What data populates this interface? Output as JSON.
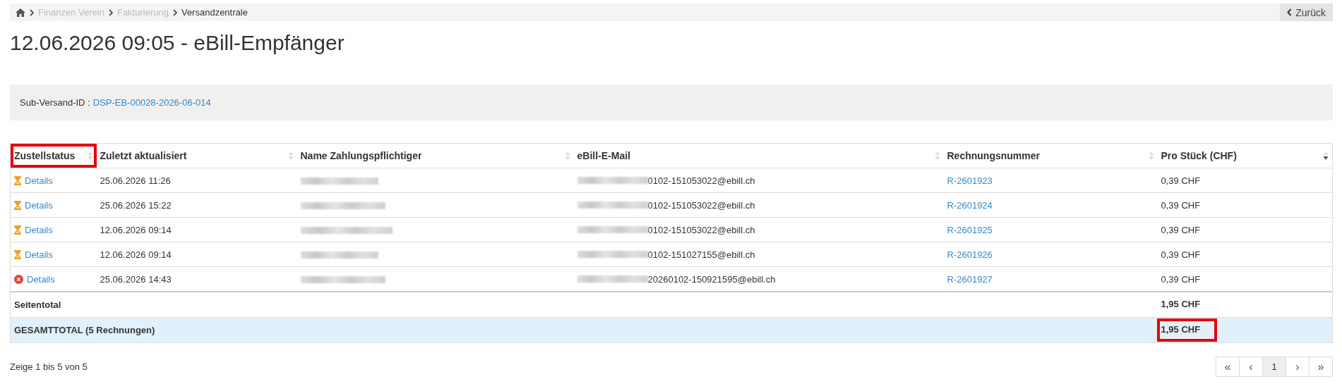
{
  "breadcrumb": {
    "items": [
      {
        "label": "Finanzen Verein",
        "current": false
      },
      {
        "label": "Fakturierung",
        "current": false
      },
      {
        "label": "Versandzentrale",
        "current": true
      }
    ],
    "back_button": "Zurück"
  },
  "title": "12.06.2026 09:05 - eBill-Empfänger",
  "info_panel": {
    "label": "Sub-Versand-ID :",
    "value": "DSP-EB-00028-2026-06-014"
  },
  "table": {
    "columns": [
      {
        "label": "Zustellstatus",
        "sorted": false,
        "highlighted": true
      },
      {
        "label": "Zuletzt aktualisiert",
        "sorted": false,
        "highlighted": false
      },
      {
        "label": "Name Zahlungspflichtiger",
        "sorted": false,
        "highlighted": false
      },
      {
        "label": "eBill-E-Mail",
        "sorted": false,
        "highlighted": false
      },
      {
        "label": "Rechnungsnummer",
        "sorted": false,
        "highlighted": false
      },
      {
        "label": "Pro Stück (CHF)",
        "sorted": true,
        "highlighted": false
      }
    ],
    "rows": [
      {
        "kind": "pending",
        "details": "Details",
        "updated": "25.06.2026 11:26",
        "email": "0102-151053022@ebill.ch",
        "invoice": "R-2601923",
        "price": "0,39 CHF"
      },
      {
        "kind": "pending",
        "details": "Details",
        "updated": "25.06.2026 15:22",
        "email": "0102-151053022@ebill.ch",
        "invoice": "R-2601924",
        "price": "0,39 CHF"
      },
      {
        "kind": "pending",
        "details": "Details",
        "updated": "12.06.2026 09:14",
        "email": "0102-151053022@ebill.ch",
        "invoice": "R-2601925",
        "price": "0,39 CHF"
      },
      {
        "kind": "pending",
        "details": "Details",
        "updated": "12.06.2026 09:14",
        "email": "0102-151027155@ebill.ch",
        "invoice": "R-2601926",
        "price": "0,39 CHF"
      },
      {
        "kind": "error",
        "details": "Details",
        "updated": "25.06.2026 14:43",
        "email": "20260102-150921595@ebill.ch",
        "invoice": "R-2601927",
        "price": "0,39 CHF"
      }
    ],
    "page_total": {
      "label": "Seitentotal",
      "value": "1,95 CHF",
      "highlighted": false
    },
    "grand_total": {
      "label": "GESAMTTOTAL (5 Rechnungen)",
      "value": "1,95 CHF",
      "highlighted": true
    }
  },
  "footer": {
    "info": "Zeige 1 bis 5 von 5",
    "pagination": [
      {
        "label": "«",
        "selected": false
      },
      {
        "label": "‹",
        "selected": false
      },
      {
        "label": "1",
        "selected": true
      },
      {
        "label": "›",
        "selected": false
      },
      {
        "label": "»",
        "selected": false
      }
    ]
  }
}
